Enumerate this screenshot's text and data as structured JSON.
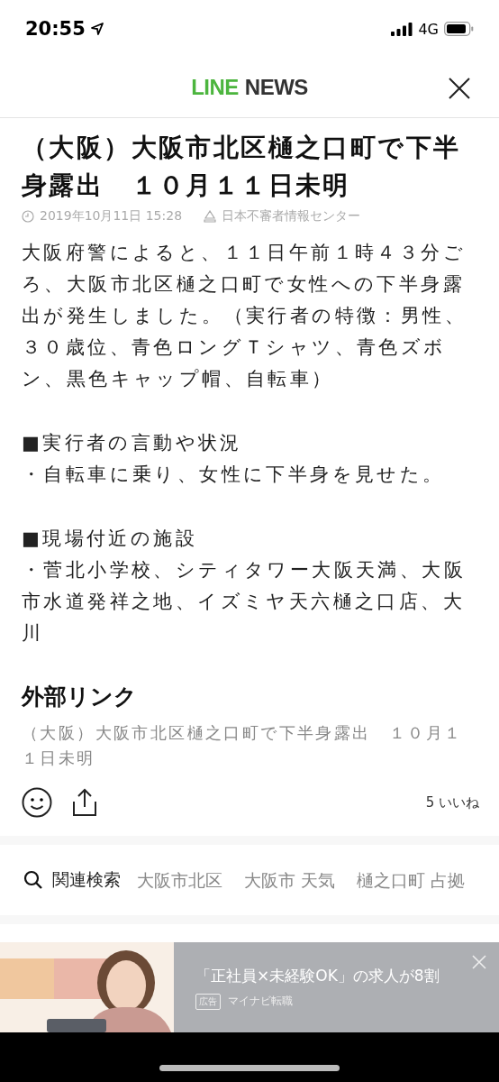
{
  "status_bar": {
    "time": "20:55",
    "network": "4G"
  },
  "header": {
    "logo_primary": "LINE",
    "logo_secondary": "NEWS"
  },
  "article": {
    "title": "（大阪）大阪市北区樋之口町で下半身露出　１０月１１日未明",
    "date": "2019年10月11日 15:28",
    "source": "日本不審者情報センター",
    "sections": [
      {
        "text": "大阪府警によると、１１日午前１時４３分ごろ、大阪市北区樋之口町で女性への下半身露出が発生しました。（実行者の特徴：男性、３０歳位、青色ロングＴシャツ、青色ズボン、黒色キャップ帽、自転車）"
      },
      {
        "heading": "■実行者の言動や状況",
        "text": "・自転車に乗り、女性に下半身を見せた。"
      },
      {
        "heading": "■現場付近の施設",
        "text": "・菅北小学校、シティタワー大阪天満、大阪市水道発祥之地、イズミヤ天六樋之口店、大川"
      }
    ]
  },
  "external_links": {
    "heading": "外部リンク",
    "links": [
      "（大阪）大阪市北区樋之口町で下半身露出　１０月１１日未明"
    ]
  },
  "actions": {
    "likes": "5 いいね"
  },
  "related_search": {
    "label": "関連検索",
    "keywords": [
      "大阪市北区",
      "大阪市 天気",
      "樋之口町 占拠"
    ]
  },
  "ad": {
    "kind": "picture",
    "headline": "「正社員×未経験OK」の求人が8割",
    "badge": "広告",
    "advertiser": "マイナビ転職"
  }
}
